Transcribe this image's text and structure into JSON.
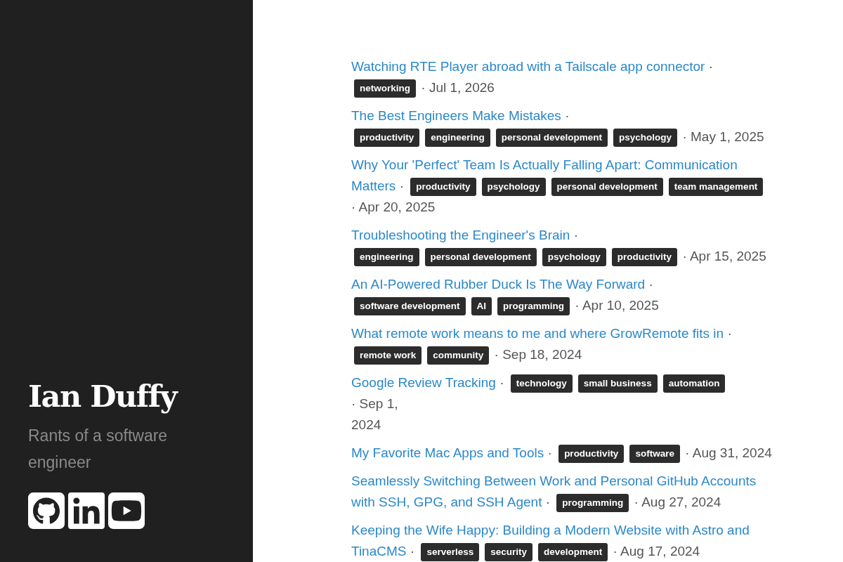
{
  "sidebar": {
    "title": "Ian Duffy",
    "tagline": "Rants of a software engineer",
    "social_links": [
      {
        "kind": "github"
      },
      {
        "kind": "linkedin"
      },
      {
        "kind": "youtube"
      }
    ]
  },
  "posts": [
    {
      "title_lines": [
        "Watching RTE Player abroad with a Tailscale app connector"
      ],
      "separator": "·",
      "tags": [
        "networking"
      ],
      "date_lines": [
        "· Jul 1, 2026"
      ]
    },
    {
      "title_lines": [
        "The Best Engineers Make Mistakes"
      ],
      "separator": "·",
      "tags": [
        "productivity",
        "engineering",
        "personal development",
        "psychology"
      ],
      "date_lines": [
        "· May 1, 2025"
      ]
    },
    {
      "title_lines": [
        "Why Your 'Perfect' Team Is Actually Falling Apart: Communication",
        "Matters"
      ],
      "separator": "·",
      "tags": [
        "productivity",
        "psychology",
        "personal development",
        "team management"
      ],
      "date_lines": [
        "· Apr 20, 2025"
      ]
    },
    {
      "title_lines": [
        "Troubleshooting the Engineer's Brain"
      ],
      "separator": "·",
      "tags": [
        "engineering",
        "personal development",
        "psychology",
        "productivity"
      ],
      "date_lines": [
        "· Apr 15, 2025"
      ]
    },
    {
      "title_lines": [
        "An AI-Powered Rubber Duck Is The Way Forward"
      ],
      "separator": "·",
      "tags": [
        "software development",
        "AI",
        "programming"
      ],
      "date_lines": [
        "· Apr 10, 2025"
      ]
    },
    {
      "title_lines": [
        "What remote work means to me and where GrowRemote fits in"
      ],
      "separator": "·",
      "tags": [
        "remote work",
        "community"
      ],
      "date_lines": [
        "· Sep 18, 2024"
      ]
    },
    {
      "title_lines": [
        "Google Review Tracking"
      ],
      "separator": "·",
      "tags": [
        "technology",
        "small business",
        "automation"
      ],
      "date_lines": [
        "· Sep 1,",
        "2024"
      ]
    },
    {
      "title_lines": [
        "My Favorite Mac Apps and Tools"
      ],
      "separator": "·",
      "tags": [
        "productivity",
        "software"
      ],
      "date_lines": [
        "· Aug 31, 2024"
      ]
    },
    {
      "title_lines": [
        "Seamlessly Switching Between Work and Personal GitHub Accounts",
        "with SSH, GPG, and SSH Agent"
      ],
      "separator": "·",
      "tags": [
        "programming"
      ],
      "date_lines": [
        "· Aug 27, 2024"
      ]
    },
    {
      "title_lines": [
        "Keeping the Wife Happy: Building a Modern Website with Astro and",
        "TinaCMS"
      ],
      "separator": "·",
      "tags": [
        "serverless",
        "security",
        "development"
      ],
      "date_lines": [
        "· Aug 17, 2024"
      ]
    }
  ]
}
